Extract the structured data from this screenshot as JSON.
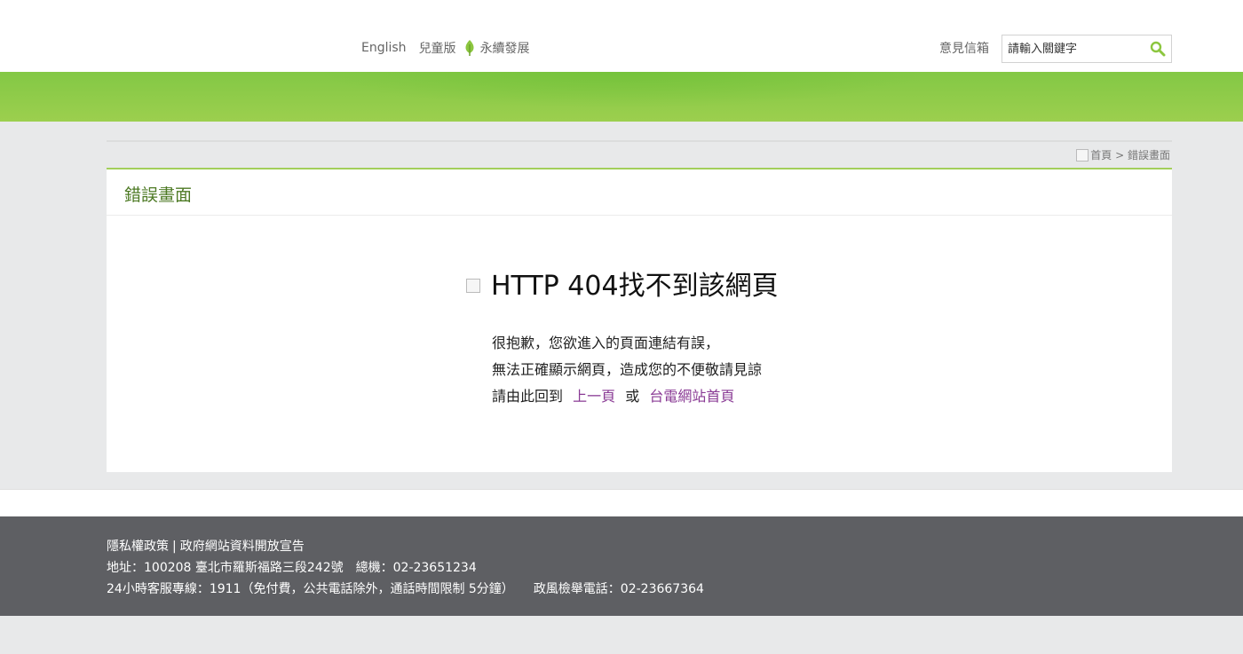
{
  "header": {
    "nav": {
      "english": "English",
      "kids": "兒童版",
      "sustainability": "永續發展"
    },
    "feedback": "意見信箱",
    "search": {
      "placeholder": "請輸入關鍵字"
    }
  },
  "breadcrumb": {
    "home": "首頁",
    "separator": " > ",
    "current": "錯誤畫面"
  },
  "panel": {
    "title": "錯誤畫面",
    "heading": "HTTP 404找不到該網頁",
    "line1": "很抱歉，您欲進入的頁面連結有誤，",
    "line2": "無法正確顯示網頁，造成您的不便敬請見諒",
    "line3_prefix": "請由此回到",
    "link_prev": "上一頁",
    "or": "或",
    "link_home": "台電網站首頁"
  },
  "footer": {
    "privacy": "隱私權政策",
    "divider": "|",
    "open_data": "政府網站資料開放宣告",
    "address": "地址：100208 臺北市羅斯福路三段242號",
    "switchboard": "總機：02-23651234",
    "hotline": "24小時客服專線：1911（免付費，公共電話除外，通話時間限制 5分鐘）",
    "ethics": "政風檢舉電話：02-23667364"
  },
  "colors": {
    "accent_green": "#8cc63f",
    "title_green": "#4d7a24",
    "link_purple": "#8a3b95",
    "footer_bg": "#5e5f63"
  }
}
